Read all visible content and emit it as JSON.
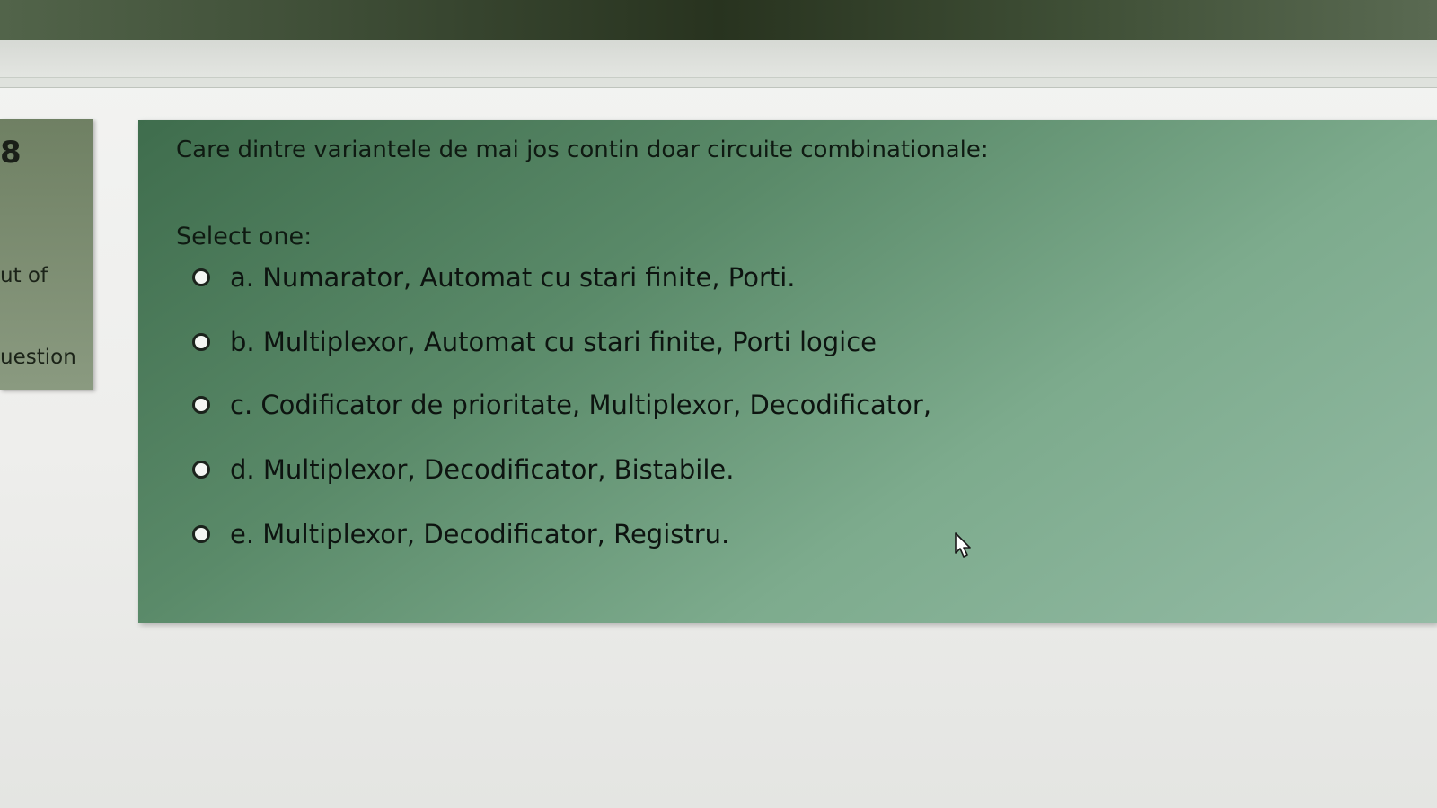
{
  "sidebar": {
    "question_number": "8",
    "line1": "ut of",
    "line2": "uestion"
  },
  "question": {
    "text": "Care dintre variantele de mai jos contin doar circuite combinationale:",
    "prompt": "Select one:",
    "options": [
      {
        "label": "a. Numarator, Automat cu stari finite, Porti."
      },
      {
        "label": "b. Multiplexor, Automat cu stari finite, Porti logice"
      },
      {
        "label": "c. Codificator de prioritate, Multiplexor, Decodificator,"
      },
      {
        "label": "d. Multiplexor, Decodificator, Bistabile."
      },
      {
        "label": "e. Multiplexor, Decodificator, Registru."
      }
    ]
  }
}
